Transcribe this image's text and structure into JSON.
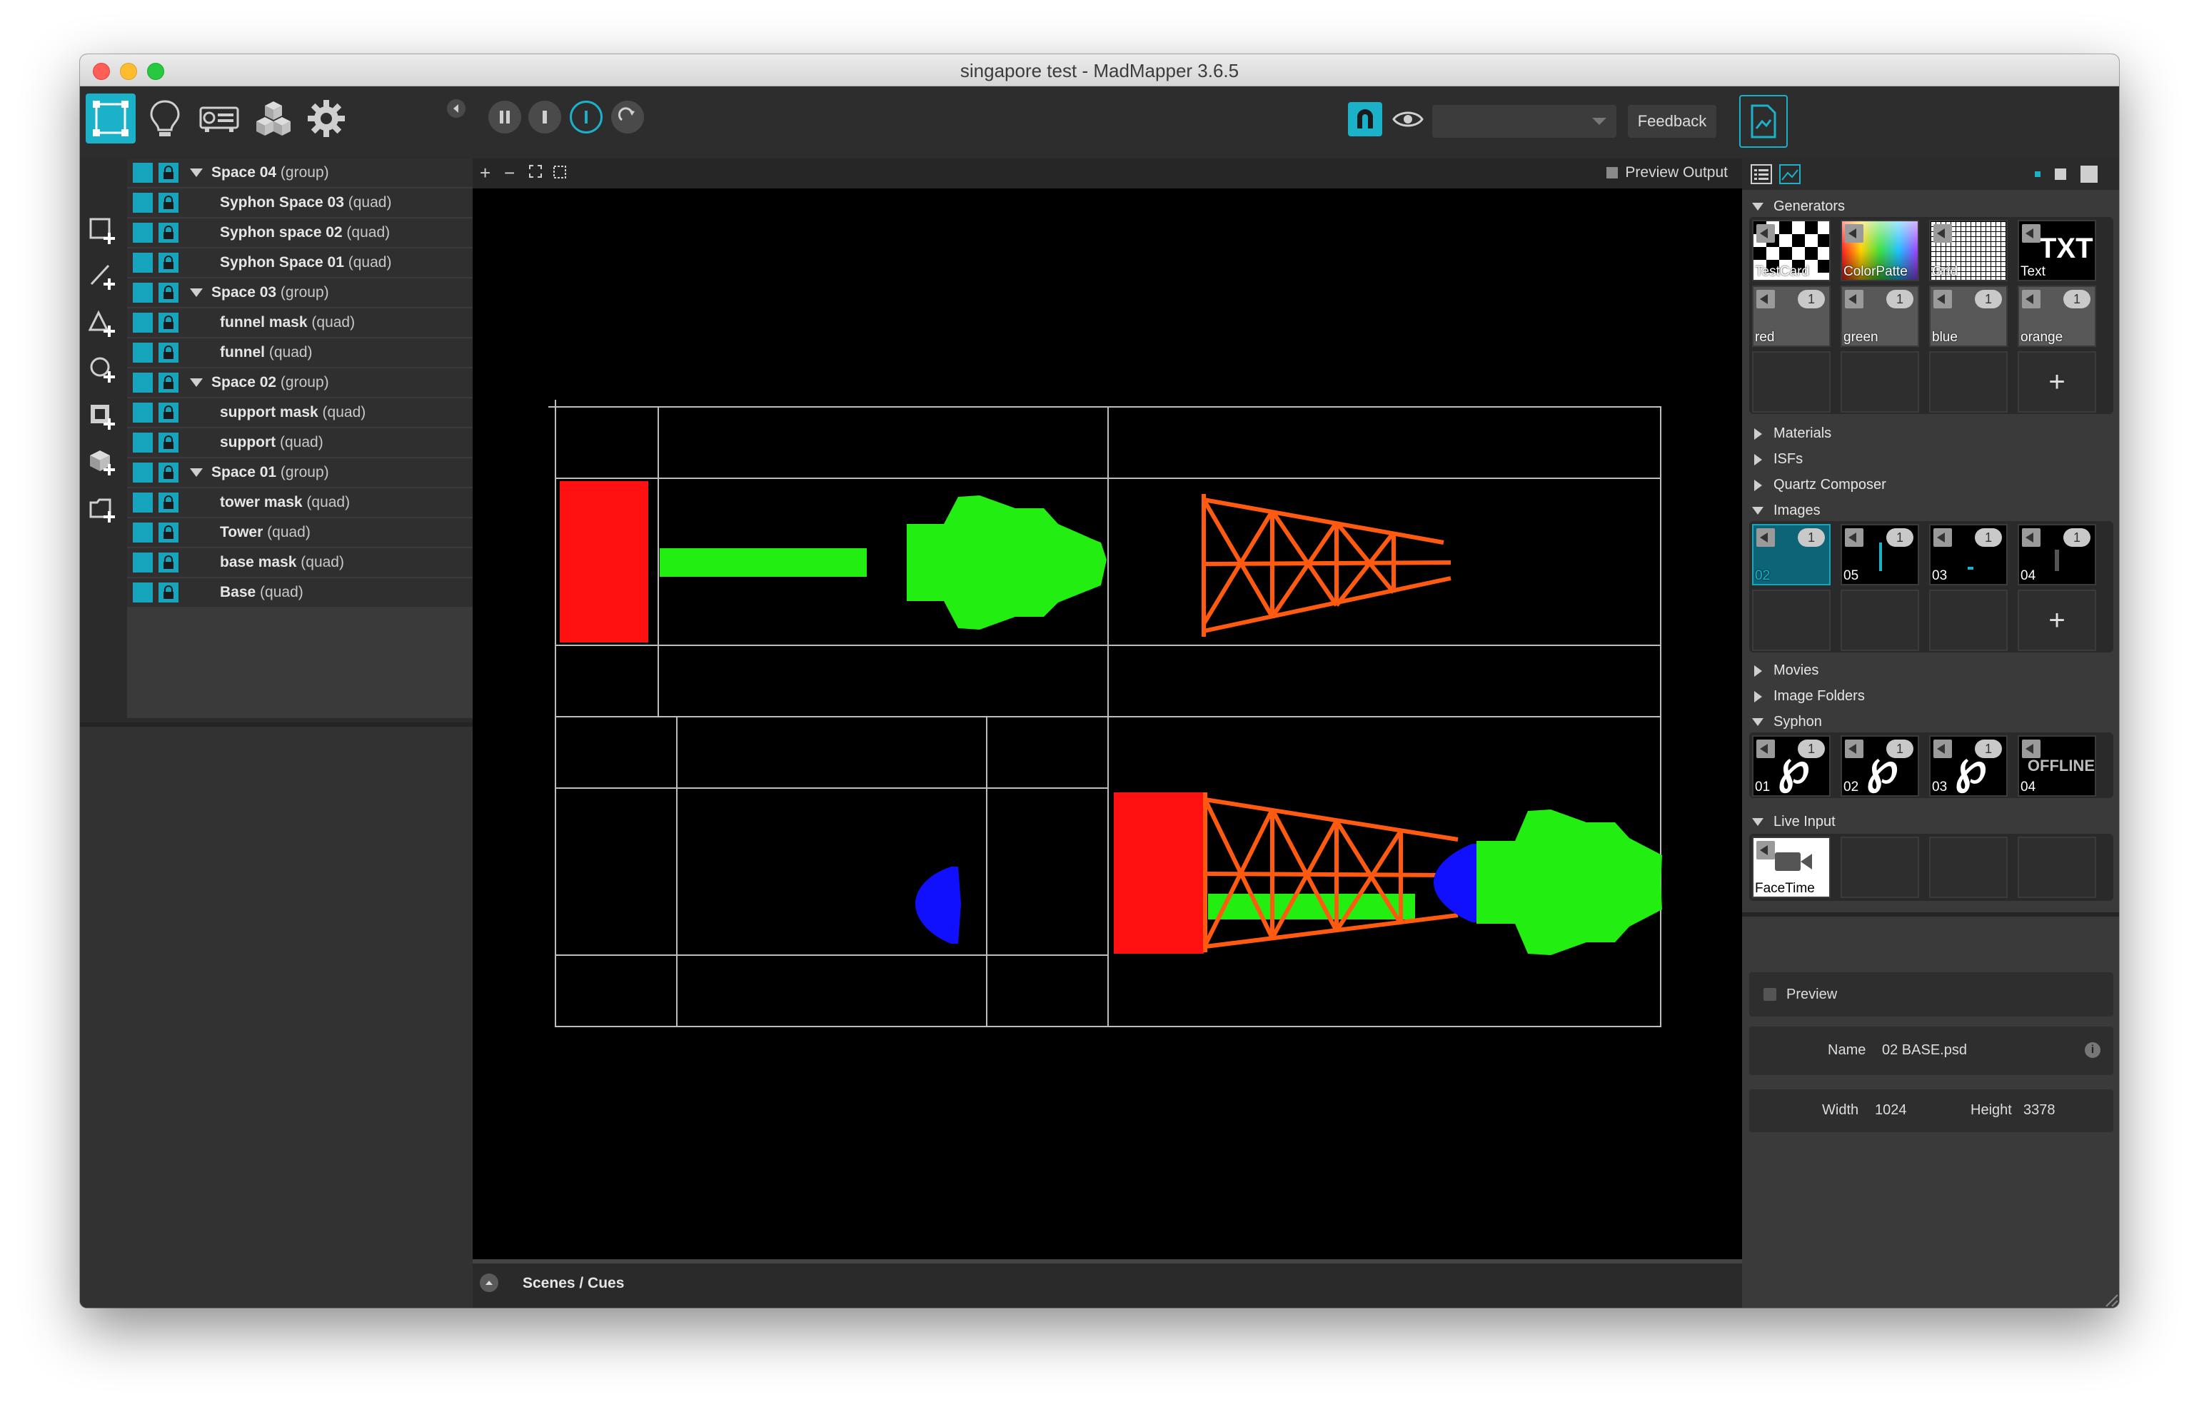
{
  "window": {
    "title": "singapore test - MadMapper 3.6.5"
  },
  "toolbar": {
    "feedback_label": "Feedback",
    "accent": "#1bb1c9"
  },
  "layers": [
    {
      "name": "Space 04",
      "kind": "(group)",
      "group": true
    },
    {
      "name": "Syphon Space 03",
      "kind": "(quad)",
      "group": false
    },
    {
      "name": "Syphon space 02",
      "kind": "(quad)",
      "group": false
    },
    {
      "name": "Syphon Space 01",
      "kind": "(quad)",
      "group": false
    },
    {
      "name": "Space 03",
      "kind": "(group)",
      "group": true
    },
    {
      "name": "funnel mask",
      "kind": "(quad)",
      "group": false
    },
    {
      "name": "funnel",
      "kind": "(quad)",
      "group": false
    },
    {
      "name": "Space 02",
      "kind": "(group)",
      "group": true
    },
    {
      "name": "support mask",
      "kind": "(quad)",
      "group": false
    },
    {
      "name": "support",
      "kind": "(quad)",
      "group": false
    },
    {
      "name": "Space 01",
      "kind": "(group)",
      "group": true
    },
    {
      "name": "tower mask",
      "kind": "(quad)",
      "group": false
    },
    {
      "name": "Tower",
      "kind": "(quad)",
      "group": false
    },
    {
      "name": "base mask",
      "kind": "(quad)",
      "group": false
    },
    {
      "name": "Base",
      "kind": "(quad)",
      "group": false
    }
  ],
  "stage": {
    "preview_output_label": "Preview Output",
    "scenes_label": "Scenes / Cues",
    "colors": {
      "red": "#ff1111",
      "green": "#22ee11",
      "orange": "#ff5a10",
      "blue": "#1010ff"
    }
  },
  "library": {
    "generators_label": "Generators",
    "generators": [
      {
        "label": "TestCard"
      },
      {
        "label": "ColorPatte"
      },
      {
        "label": "Grid"
      },
      {
        "label": "Text"
      },
      {
        "label": "red",
        "count": "1"
      },
      {
        "label": "green",
        "count": "1"
      },
      {
        "label": "blue",
        "count": "1"
      },
      {
        "label": "orange",
        "count": "1"
      }
    ],
    "materials_label": "Materials",
    "isfs_label": "ISFs",
    "quartz_label": "Quartz Composer",
    "images_label": "Images",
    "images": [
      {
        "label": "02",
        "count": "1"
      },
      {
        "label": "05",
        "count": "1"
      },
      {
        "label": "03",
        "count": "1"
      },
      {
        "label": "04",
        "count": "1"
      }
    ],
    "movies_label": "Movies",
    "image_folders_label": "Image Folders",
    "syphon_label": "Syphon",
    "syphon": [
      {
        "label": "01",
        "count": "1"
      },
      {
        "label": "02",
        "count": "1"
      },
      {
        "label": "03",
        "count": "1"
      },
      {
        "label": "04",
        "overlay": "OFFLINE"
      }
    ],
    "live_input_label": "Live Input",
    "live_inputs": [
      {
        "label": "FaceTime"
      }
    ],
    "plus": "+"
  },
  "preview": {
    "label": "Preview",
    "name_label": "Name",
    "name_value": "02 BASE.psd",
    "info": "i",
    "width_label": "Width",
    "width_value": "1024",
    "height_label": "Height",
    "height_value": "3378"
  }
}
